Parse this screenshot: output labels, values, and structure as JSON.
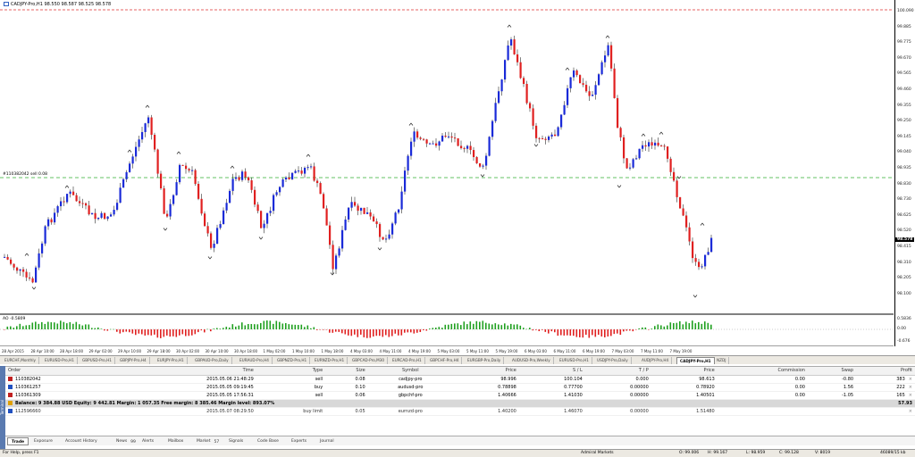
{
  "chart": {
    "title": "CADJPY-Pro,H1  98.550 98.587 98.525 98.578",
    "order_line_label": "#110382042 sell 0.08",
    "ao_label": "AO -0.5809",
    "price_labels": [
      "100.090",
      "99.885",
      "99.775",
      "99.670",
      "99.565",
      "99.460",
      "99.355",
      "99.250",
      "99.145",
      "99.040",
      "98.935",
      "98.830",
      "98.730",
      "98.625",
      "98.520",
      "98.415",
      "98.310",
      "98.205",
      "98.100"
    ],
    "current_price": "98.578",
    "ao_scale_labels": [
      "0.5836",
      "0.00",
      "-0.676"
    ],
    "time_labels": [
      "28 Apr 2015",
      "28 Apr 10:00",
      "28 Apr 18:00",
      "29 Apr 02:00",
      "29 Apr 10:00",
      "29 Apr 18:00",
      "30 Apr 02:00",
      "30 Apr 10:00",
      "30 Apr 18:00",
      "1 May 02:00",
      "1 May 10:00",
      "1 May 18:00",
      "4 May 03:00",
      "4 May 11:00",
      "4 May 19:00",
      "5 May 03:00",
      "5 May 11:00",
      "5 May 19:00",
      "6 May 03:00",
      "6 May 11:00",
      "6 May 19:00",
      "7 May 03:00",
      "7 May 11:00",
      "7 May 19:00"
    ],
    "colors": {
      "bull": "#1a2ad8",
      "bear": "#e02020",
      "ao_up": "#20a020",
      "ao_down": "#e02020",
      "top_line": "#e03030",
      "order_line": "#30b030"
    }
  },
  "chart_tabs": [
    "EURCHF,Monthly",
    "EURUSD-Pro,H1",
    "GBPUSD-Pro,H1",
    "GBPJPY-Pro,H4",
    "EURJPY-Pro,H1",
    "GBPAUD-Pro,Daily",
    "EURAUD-Pro,H4",
    "GBPNZD-Pro,H1",
    "EURNZD-Pro,H1",
    "GBPCAD-Pro,M30",
    "EURCAD-Pro,H1",
    "GBPCHF-Pro,H4",
    "EURGBP-Pro,Daily",
    "AUDUSD-Pro,Weekly",
    "EURUSD-Pro,H1",
    "USDJPY-Pro,Daily",
    "AUDJPY-Pro,H4",
    "CADJPY-Pro,H1",
    "NZDJ"
  ],
  "terminal": {
    "columns": [
      "Order",
      "Time",
      "Type",
      "Size",
      "Symbol",
      "Price",
      "S / L",
      "T / P",
      "Price",
      "Commission",
      "Swap",
      "Profit"
    ],
    "rows": [
      {
        "order": "110382042",
        "time": "2015.05.06 21:48:29",
        "type": "sell",
        "size": "0.08",
        "symbol": "cadjpy-pro",
        "price": "98.996",
        "sl": "100.104",
        "tp": "0.000",
        "cur": "98.613",
        "commission": "0.00",
        "swap": "-0.80",
        "profit": "383"
      },
      {
        "order": "110361257",
        "time": "2015.05.05 09:19:45",
        "type": "buy",
        "size": "0.10",
        "symbol": "audusd-pro",
        "price": "0.78898",
        "sl": "0.77700",
        "tp": "0.00000",
        "cur": "0.78920",
        "commission": "0.00",
        "swap": "1.56",
        "profit": "222"
      },
      {
        "order": "110361309",
        "time": "2015.05.05 17:56:31",
        "type": "sell",
        "size": "0.06",
        "symbol": "gbpchf-pro",
        "price": "1.40666",
        "sl": "1.41030",
        "tp": "0.00000",
        "cur": "1.40501",
        "commission": "0.00",
        "swap": "-1.05",
        "profit": "165"
      }
    ],
    "balance": "Balance: 9 384.88 USD  Equity: 9 442.81  Margin: 1 057.35  Free margin: 8 385.46  Margin level: 893.07%",
    "balance_profit": "57.93",
    "pending": {
      "order": "112596660",
      "time": "2015.05.07 08:29:50",
      "type": "buy limit",
      "size": "0.05",
      "symbol": "eurnzd-pro",
      "price": "1.40200",
      "sl": "1.46070",
      "tp": "0.00000",
      "cur": "1.51480"
    }
  },
  "bottom_tabs": [
    {
      "label": "Trade",
      "badge": ""
    },
    {
      "label": "Exposure",
      "badge": ""
    },
    {
      "label": "Account History",
      "badge": ""
    },
    {
      "label": "News",
      "badge": "99"
    },
    {
      "label": "Alerts",
      "badge": ""
    },
    {
      "label": "Mailbox",
      "badge": ""
    },
    {
      "label": "Market",
      "badge": "57"
    },
    {
      "label": "Signals",
      "badge": ""
    },
    {
      "label": "Code Base",
      "badge": ""
    },
    {
      "label": "Experts",
      "badge": ""
    },
    {
      "label": "Journal",
      "badge": ""
    }
  ],
  "side_label": "Terminal",
  "status": {
    "help": "For Help, press F1",
    "profile": "Admiral Markets",
    "open": "O: 99.006",
    "high": "H: 99.167",
    "low": "L: 98.959",
    "close": "C: 99.128",
    "volume": "V: 8019",
    "traffic": "46089/15 kb"
  }
}
